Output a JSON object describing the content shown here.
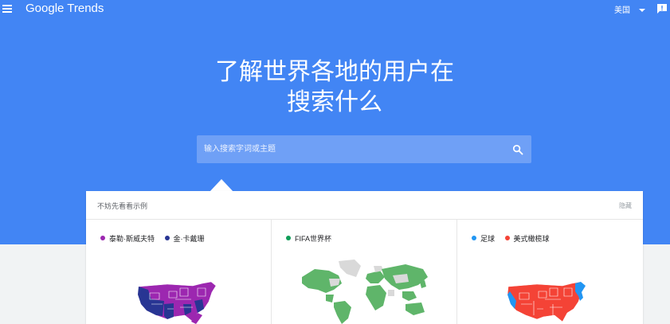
{
  "header": {
    "logo": "Google Trends",
    "region": "美国"
  },
  "hero": {
    "line1": "了解世界各地的用户在",
    "line2": "搜索什么"
  },
  "search": {
    "placeholder": "输入搜索字词或主题"
  },
  "examples": {
    "title": "不妨先看看示例",
    "hide_label": "隐藏",
    "cards": [
      {
        "legend": [
          {
            "label": "泰勒·斯威夫特",
            "color": "#9c27b0"
          },
          {
            "label": "金·卡戴珊",
            "color": "#283593"
          }
        ]
      },
      {
        "legend": [
          {
            "label": "FIFA世界杯",
            "color": "#0f9d58"
          }
        ]
      },
      {
        "legend": [
          {
            "label": "足球",
            "color": "#2196f3"
          },
          {
            "label": "美式橄榄球",
            "color": "#f44336"
          }
        ]
      }
    ]
  },
  "colors": {
    "brand_blue": "#4285f4",
    "search_bg": "#6fa0f6",
    "map_purple": "#9c27b0",
    "map_navy": "#283593",
    "map_green": "#5fb56a",
    "map_gray": "#d9d9d9",
    "map_red": "#f44336",
    "map_blue": "#2196f3"
  }
}
